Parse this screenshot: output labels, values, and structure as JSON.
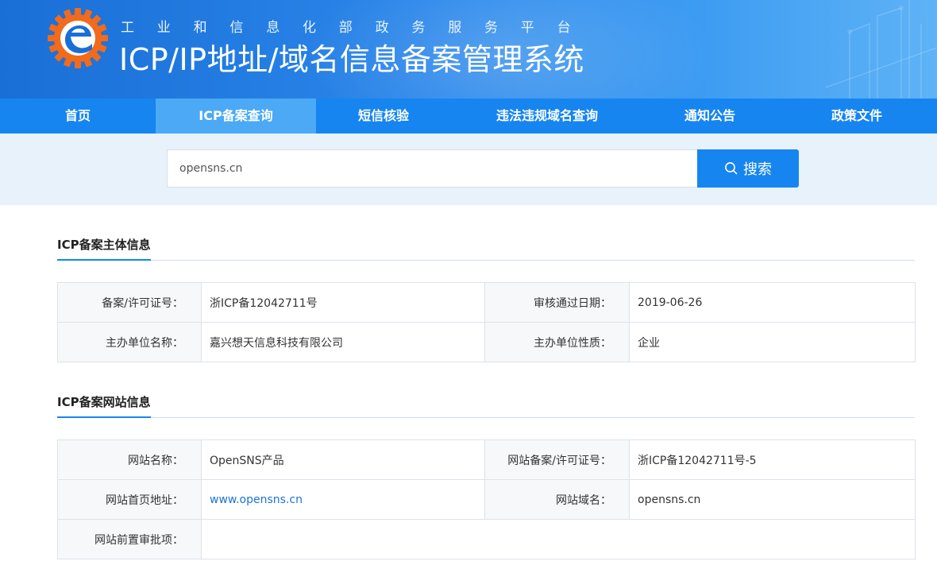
{
  "header": {
    "subtitle": "工业和信息化部政务服务平台",
    "title": "ICP/IP地址/域名信息备案管理系统",
    "logo_icon": "miit-gear-e-logo"
  },
  "nav": {
    "items": [
      {
        "label": "首页"
      },
      {
        "label": "ICP备案查询"
      },
      {
        "label": "短信核验"
      },
      {
        "label": "违法违规域名查询"
      },
      {
        "label": "通知公告"
      },
      {
        "label": "政策文件"
      }
    ],
    "active": "ICP备案查询"
  },
  "search": {
    "value": "opensns.cn",
    "button_label": "搜索",
    "button_icon": "search-icon"
  },
  "subject": {
    "section_title": "ICP备案主体信息",
    "license_label": "备案/许可证号：",
    "license_value": "浙ICP备12042711号",
    "approve_date_label": "审核通过日期：",
    "approve_date_value": "2019-06-26",
    "org_name_label": "主办单位名称：",
    "org_name_value": "嘉兴想天信息科技有限公司",
    "org_type_label": "主办单位性质：",
    "org_type_value": "企业"
  },
  "website": {
    "section_title": "ICP备案网站信息",
    "site_name_label": "网站名称：",
    "site_name_value": "OpenSNS产品",
    "site_license_label": "网站备案/许可证号：",
    "site_license_value": "浙ICP备12042711号-5",
    "homepage_label": "网站首页地址：",
    "homepage_value": "www.opensns.cn",
    "domain_label": "网站域名：",
    "domain_value": "opensns.cn",
    "preapproval_label": "网站前置审批项：",
    "preapproval_value": ""
  },
  "colors": {
    "nav_bg": "#1685f0",
    "nav_active": "#4ba9f5",
    "search_band": "#e8f2fb",
    "link": "#1a73d8"
  }
}
